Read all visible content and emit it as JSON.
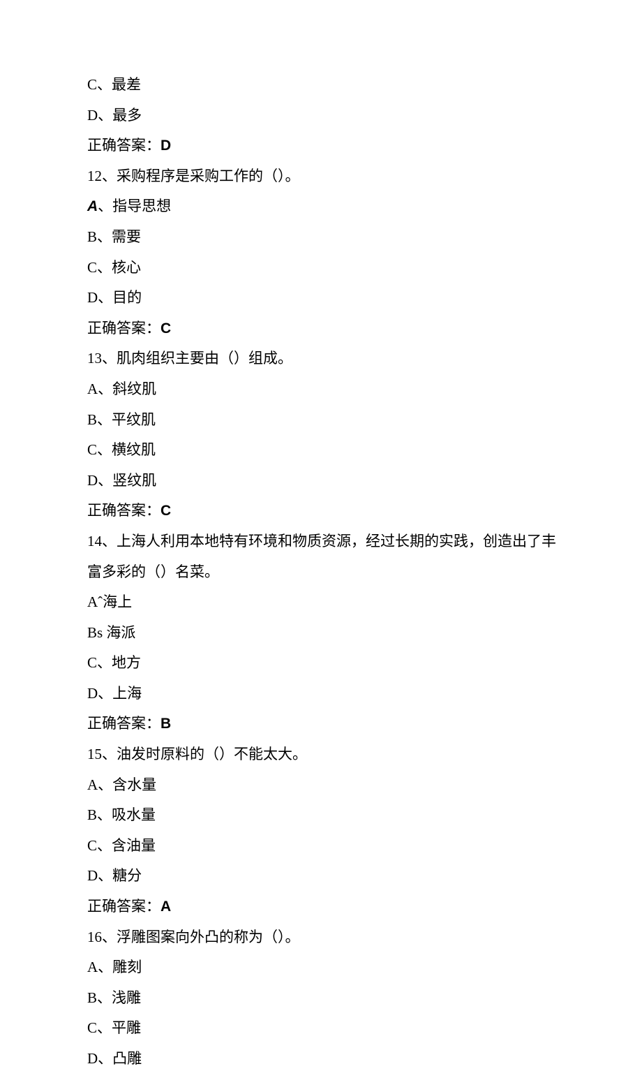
{
  "lines": [
    {
      "type": "option",
      "text": "C、最差"
    },
    {
      "type": "option",
      "text": "D、最多"
    },
    {
      "type": "answer",
      "prefix": "正确答案：",
      "value": "D"
    },
    {
      "type": "question",
      "text": "12、采购程序是采购工作的（）。"
    },
    {
      "type": "option-italic",
      "prefix": "A",
      "text": "、指导思想"
    },
    {
      "type": "option",
      "text": "B、需要"
    },
    {
      "type": "option",
      "text": "C、核心"
    },
    {
      "type": "option",
      "text": "D、目的"
    },
    {
      "type": "answer",
      "prefix": "正确答案：",
      "value": "C"
    },
    {
      "type": "question",
      "text": "13、肌肉组织主要由（）组成。"
    },
    {
      "type": "option",
      "text": "A、斜纹肌"
    },
    {
      "type": "option",
      "text": "B、平纹肌"
    },
    {
      "type": "option",
      "text": "C、横纹肌"
    },
    {
      "type": "option",
      "text": "D、竖纹肌"
    },
    {
      "type": "answer",
      "prefix": "正确答案：",
      "value": "C"
    },
    {
      "type": "question-wrap",
      "text1": "14、上海人利用本地特有环境和物质资源，经过长期的实践，创造出了丰",
      "text2": "富多彩的（）名菜。"
    },
    {
      "type": "option",
      "text": "Aˆ海上"
    },
    {
      "type": "option",
      "text": "Bs 海派"
    },
    {
      "type": "option",
      "text": "C、地方"
    },
    {
      "type": "option",
      "text": "D、上海"
    },
    {
      "type": "answer",
      "prefix": "正确答案：",
      "value": "B"
    },
    {
      "type": "question",
      "text": "15、油发时原料的（）不能太大。"
    },
    {
      "type": "option",
      "text": "A、含水量"
    },
    {
      "type": "option",
      "text": "B、吸水量"
    },
    {
      "type": "option",
      "text": "C、含油量"
    },
    {
      "type": "option",
      "text": "D、糖分"
    },
    {
      "type": "answer",
      "prefix": "正确答案：",
      "value": "A"
    },
    {
      "type": "question",
      "text": "16、浮雕图案向外凸的称为（）。"
    },
    {
      "type": "option",
      "text": "A、雕刻"
    },
    {
      "type": "option",
      "text": "B、浅雕"
    },
    {
      "type": "option",
      "text": "C、平雕"
    },
    {
      "type": "option",
      "text": "D、凸雕"
    }
  ]
}
